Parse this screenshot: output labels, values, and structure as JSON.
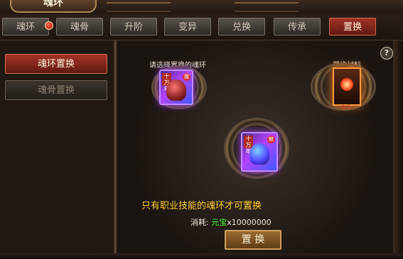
{
  "window": {
    "title": "魂环"
  },
  "tabs": [
    {
      "label": "魂环"
    },
    {
      "label": "魂骨"
    },
    {
      "label": "升阶"
    },
    {
      "label": "变异"
    },
    {
      "label": "兑换"
    },
    {
      "label": "传承"
    },
    {
      "label": "置换"
    }
  ],
  "sidebar": {
    "items": [
      {
        "label": "魂环置换"
      },
      {
        "label": "魂骨置换"
      }
    ]
  },
  "main": {
    "help_label": "?",
    "select_label": "请选择置换的魂环",
    "material_label": "置换材料",
    "material_count": "0/1",
    "left_card": {
      "tag": "十万年",
      "badge": "魔"
    },
    "center_card": {
      "tag": "十万年",
      "badge": "魅"
    },
    "info_text": "只有职业技能的魂环才可置换",
    "cost_label": "消耗:",
    "currency": "元宝",
    "amount": "x10000000",
    "confirm_label": "置 换"
  },
  "colors": {
    "active_tab": "#a13225",
    "text_highlight": "#ffcd2f",
    "currency": "#44ff3d",
    "card_glow": "#b443ff",
    "material_glow": "#ff7b18"
  }
}
